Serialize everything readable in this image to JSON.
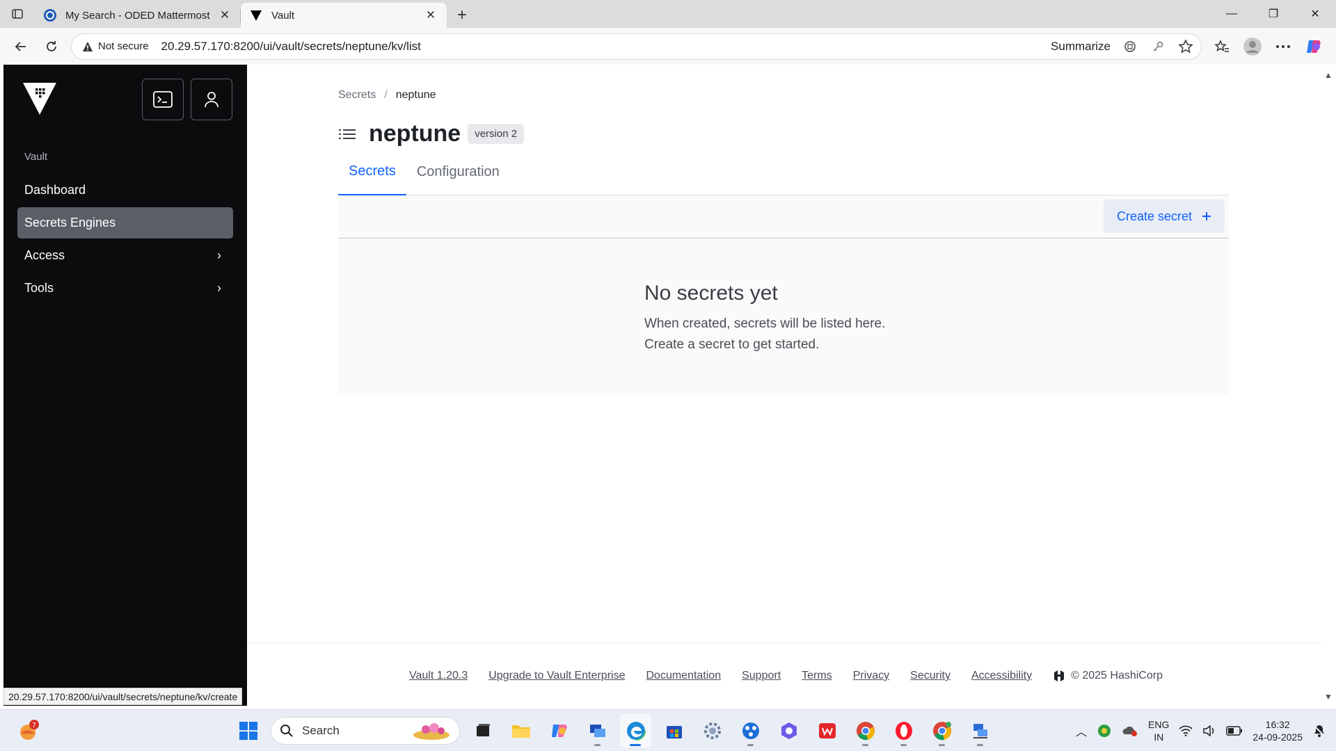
{
  "browser": {
    "tabs": [
      {
        "title": "My Search - ODED Mattermost",
        "active": false
      },
      {
        "title": "Vault",
        "active": true
      }
    ],
    "security_label": "Not secure",
    "url": "20.29.57.170:8200/ui/vault/secrets/neptune/kv/list",
    "summarize_label": "Summarize",
    "status_url": "20.29.57.170:8200/ui/vault/secrets/neptune/kv/create"
  },
  "sidebar": {
    "section_label": "Vault",
    "items": [
      {
        "label": "Dashboard",
        "active": false,
        "has_children": false
      },
      {
        "label": "Secrets Engines",
        "active": true,
        "has_children": false
      },
      {
        "label": "Access",
        "active": false,
        "has_children": true
      },
      {
        "label": "Tools",
        "active": false,
        "has_children": true
      }
    ]
  },
  "main": {
    "breadcrumb": {
      "root": "Secrets",
      "separator": "/",
      "current": "neptune"
    },
    "title": "neptune",
    "version_badge": "version 2",
    "tabs": [
      {
        "label": "Secrets",
        "active": true
      },
      {
        "label": "Configuration",
        "active": false
      }
    ],
    "create_button": "Create secret",
    "empty_state": {
      "title": "No secrets yet",
      "line1": "When created, secrets will be listed here.",
      "line2": "Create a secret to get started."
    }
  },
  "footer": {
    "links": [
      "Vault 1.20.3",
      "Upgrade to Vault Enterprise",
      "Documentation",
      "Support",
      "Terms",
      "Privacy",
      "Security",
      "Accessibility"
    ],
    "copyright": "© 2025 HashiCorp"
  },
  "taskbar": {
    "weather_badge": "7",
    "search_label": "Search",
    "lang_top": "ENG",
    "lang_bottom": "IN",
    "time": "16:32",
    "date": "24-09-2025"
  },
  "colors": {
    "sidebar_bg": "#0c0c0e",
    "sidebar_active": "#5b5e66",
    "accent": "#1060ff"
  }
}
